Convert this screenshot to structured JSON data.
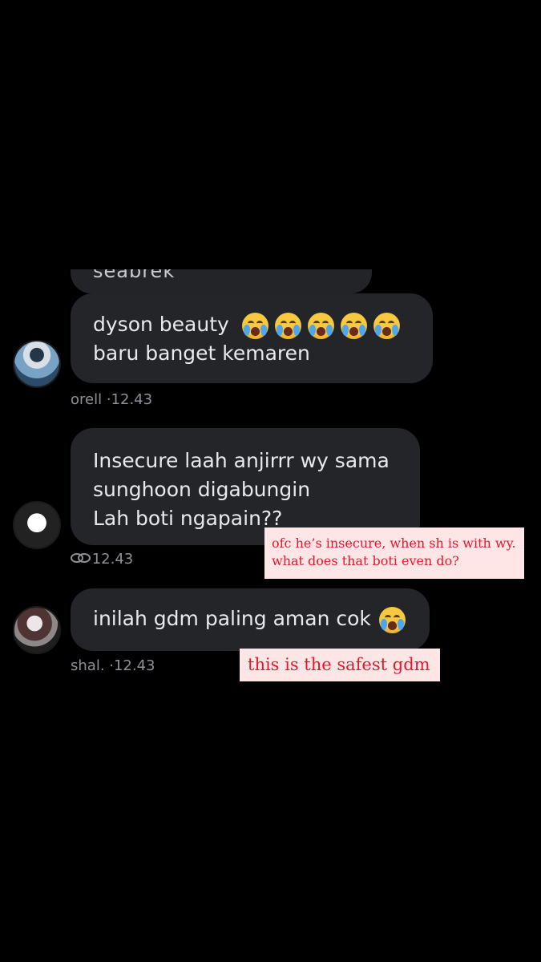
{
  "partial_top_text": "seabrek",
  "comments": [
    {
      "lines": [
        "dyson beauty",
        "baru banget kemaren"
      ],
      "emoji_count": 5,
      "meta": "orell ·12.43"
    },
    {
      "lines": [
        "Insecure laah anjirrr wy sama",
        "sunghoon digabungin",
        "Lah boti ngapain??"
      ],
      "meta": "·12.43"
    },
    {
      "lines": [
        "inilah gdm paling aman cok"
      ],
      "emoji_count": 1,
      "meta": "shal. ·12.43"
    }
  ],
  "annotations": [
    {
      "line1": "ofc he’s insecure, when sh is with wy.",
      "line2": "what does that boti even do?"
    },
    {
      "text": "this is the safest gdm"
    }
  ],
  "colors": {
    "background": "#000000",
    "bubble": "#242529",
    "note_background": "#ffe6e6",
    "note_text": "#e0182e"
  }
}
